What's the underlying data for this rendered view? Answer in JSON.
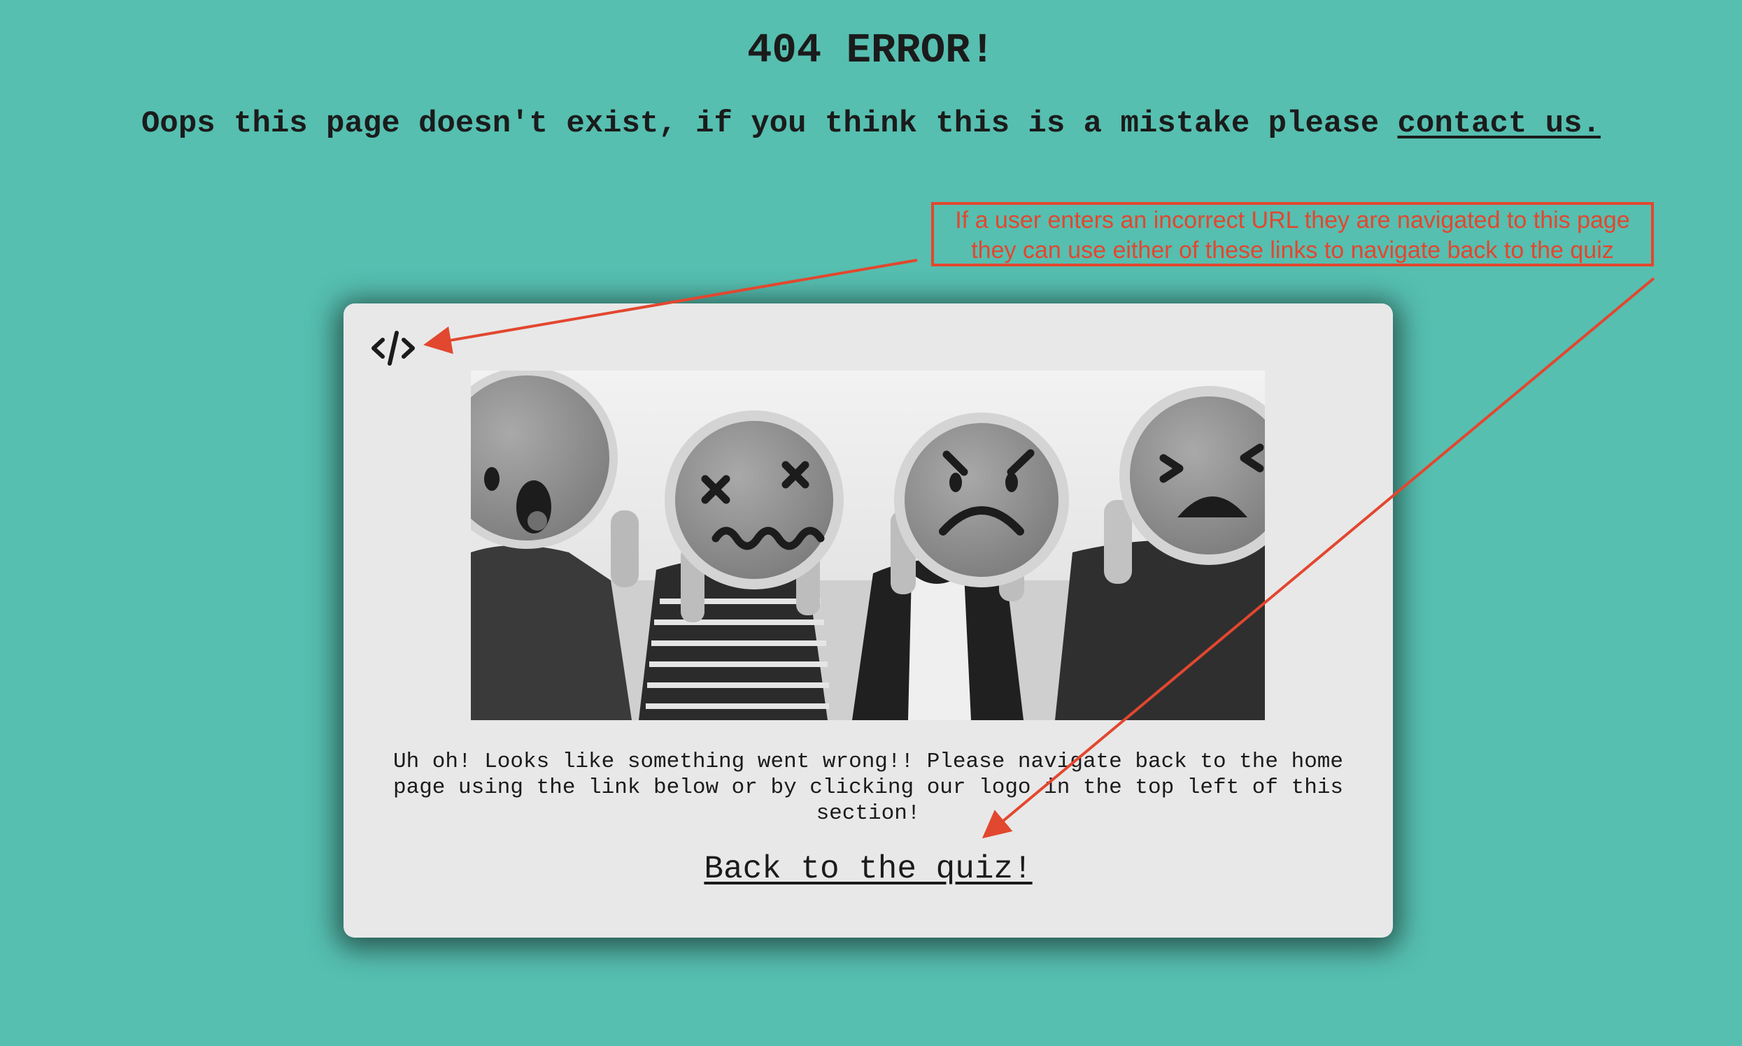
{
  "header": {
    "title": "404 ERROR!",
    "message_prefix": "Oops this page doesn't exist, if you think this is a mistake please ",
    "contact_link": "contact us."
  },
  "annotation": {
    "line1": "If a user enters an incorrect URL they are navigated to this page",
    "line2": "they can use either of these links to navigate back to the quiz",
    "color": "#e2472f"
  },
  "card": {
    "logo_icon": "code-brackets-icon",
    "image_icon": "people-holding-emoji-faces-photo",
    "body_text": "Uh oh! Looks like something went wrong!! Please navigate back to the home page using the link below or by clicking our logo in the top left of this section!",
    "back_link": "Back to the quiz!"
  },
  "colors": {
    "background": "#56bfb0",
    "card": "#e8e8e8",
    "text": "#1b1b1b"
  }
}
